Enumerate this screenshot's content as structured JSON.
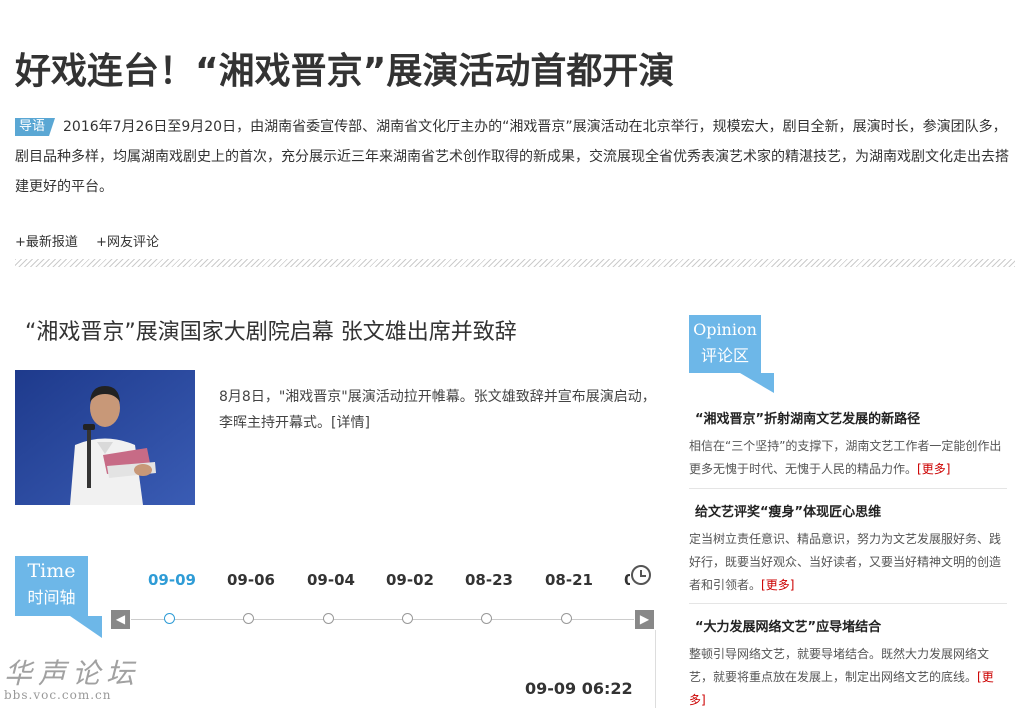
{
  "title": "好戏连台！“湘戏晋京”展演活动首都开演",
  "lead": {
    "tag": "导语",
    "text": "2016年7月26日至9月20日，由湖南省委宣传部、湖南省文化厅主办的“湘戏晋京”展演活动在北京举行，规模宏大，剧目全新，展演时长，参演团队多，剧目品种多样，均属湖南戏剧史上的首次，充分展示近三年来湖南省艺术创作取得的新成果，交流展现全省优秀表演艺术家的精湛技艺，为湖南戏剧文化走出去搭建更好的平台。"
  },
  "links": [
    "+最新报道",
    "+网友评论"
  ],
  "article": {
    "title": "“湘戏晋京”展演国家大剧院启幕 张文雄出席并致辞",
    "summary": "8月8日，\"湘戏晋京\"展演活动拉开帷幕。张文雄致辞并宣布展演启动，李晖主持开幕式。",
    "more": "[详情]"
  },
  "timeline": {
    "label_en": "Time",
    "label_cn": "时间轴",
    "dates": [
      "09-09",
      "09-06",
      "09-04",
      "09-02",
      "08-23",
      "08-21",
      "0"
    ],
    "active_index": 0,
    "prev_glyph": "◀",
    "next_glyph": "▶",
    "timestamp": "09-09 06:22"
  },
  "opinion": {
    "label_en": "Opinion",
    "label_cn": "评论区",
    "items": [
      {
        "title": "“湘戏晋京”折射湖南文艺发展的新路径",
        "body": "相信在“三个坚持”的支撑下，湖南文艺工作者一定能创作出更多无愧于时代、无愧于人民的精品力作。",
        "more": "[更多]"
      },
      {
        "title": "给文艺评奖“瘦身”体现匠心思维",
        "body": "定当树立责任意识、精品意识，努力为文艺发展服好务、践好行，既要当好观众、当好读者，又要当好精神文明的创造者和引领者。",
        "more": "[更多]"
      },
      {
        "title": "“大力发展网络文艺”应导堵结合",
        "body": "整顿引导网络文艺，就要导堵结合。既然大力发展网络文艺，就要将重点放在发展上，制定出网络文艺的底线。",
        "more": "[更多]"
      }
    ]
  },
  "watermark": {
    "text": "华声论坛",
    "url": "bbs.voc.com.cn"
  }
}
